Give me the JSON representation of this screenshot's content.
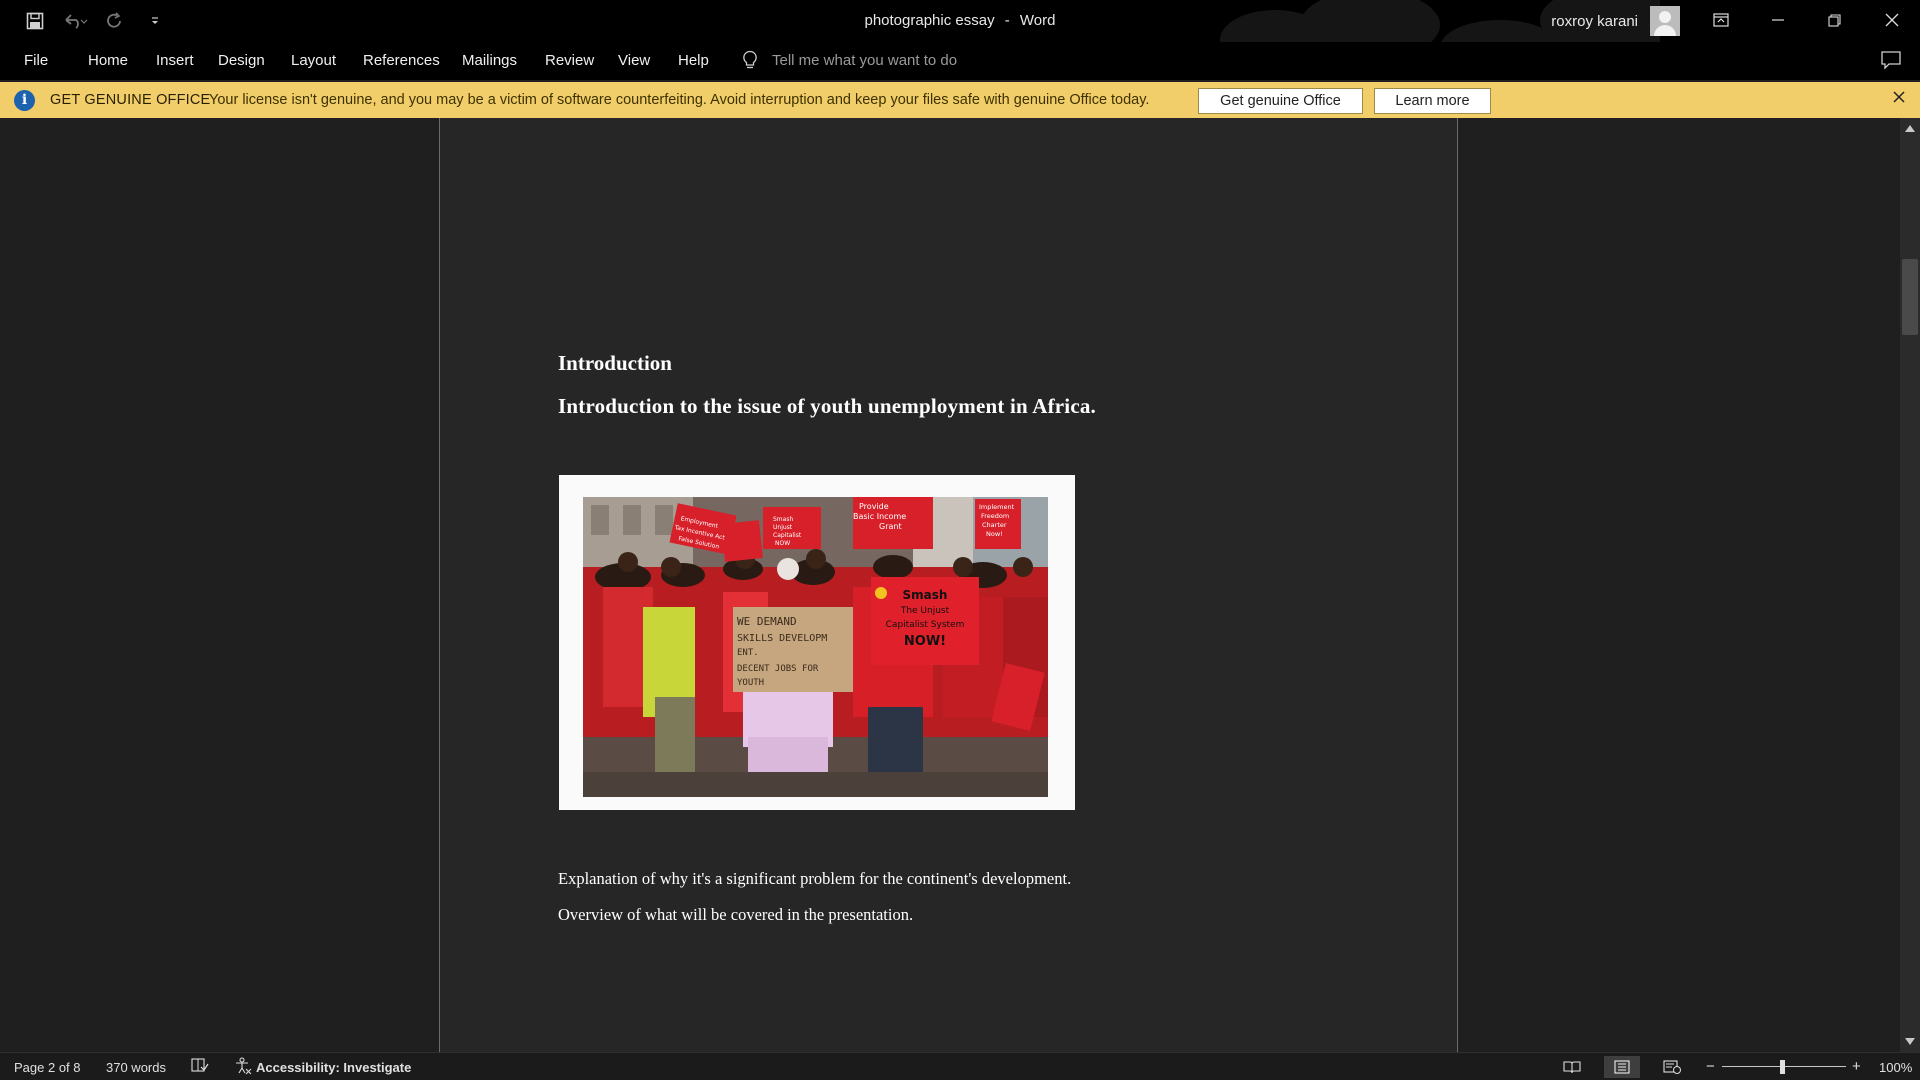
{
  "titlebar": {
    "document_name": "photographic essay",
    "separator": "-",
    "app_name": "Word",
    "user_name": "roxroy karani",
    "qat": [
      "save-icon",
      "undo-icon",
      "redo-icon",
      "customize-icon"
    ],
    "window_controls": [
      "ribbon-display-icon",
      "minimize-icon",
      "restore-icon",
      "close-icon"
    ]
  },
  "ribbon": {
    "tabs": [
      "File",
      "Home",
      "Insert",
      "Design",
      "Layout",
      "References",
      "Mailings",
      "Review",
      "View",
      "Help"
    ],
    "tell_me_placeholder": "Tell me what you want to do"
  },
  "genuine_bar": {
    "heading": "GET GENUINE OFFICE",
    "message": "Your license isn't genuine, and you may be a victim of software counterfeiting. Avoid interruption and keep your files safe with genuine Office today.",
    "primary_button": "Get genuine Office",
    "secondary_button": "Learn more",
    "background": "#f2ce6b"
  },
  "document": {
    "heading1": "Introduction",
    "heading2": "Introduction to the issue of youth unemployment in Africa.",
    "paragraphs": [
      "Explanation of why it's a significant problem for the continent's development.",
      "Overview of what will be covered in the presentation."
    ],
    "photo_signs": {
      "cardboard": [
        "WE DEMAND",
        "SKILLS DEVELOPM",
        "ENT.",
        "DECENT JOBS FOR",
        "YOUTH"
      ],
      "main_red_sign": [
        "Smash",
        "The Unjust",
        "Capitalist System",
        "NOW!"
      ],
      "top_signs": [
        "Provide",
        "Basic Income",
        "Grant",
        "Implement",
        "Freedom",
        "Charter",
        "Now!",
        "Employment",
        "Tax Incentive Act",
        "False Solution",
        "Smash",
        "Unjust",
        "Capitalist",
        "NOW"
      ]
    }
  },
  "statusbar": {
    "page": "Page 2 of 8",
    "words": "370 words",
    "accessibility": "Accessibility: Investigate",
    "zoom": "100%",
    "zoom_minus": "−",
    "zoom_plus": "+",
    "active_view": "print-layout"
  }
}
